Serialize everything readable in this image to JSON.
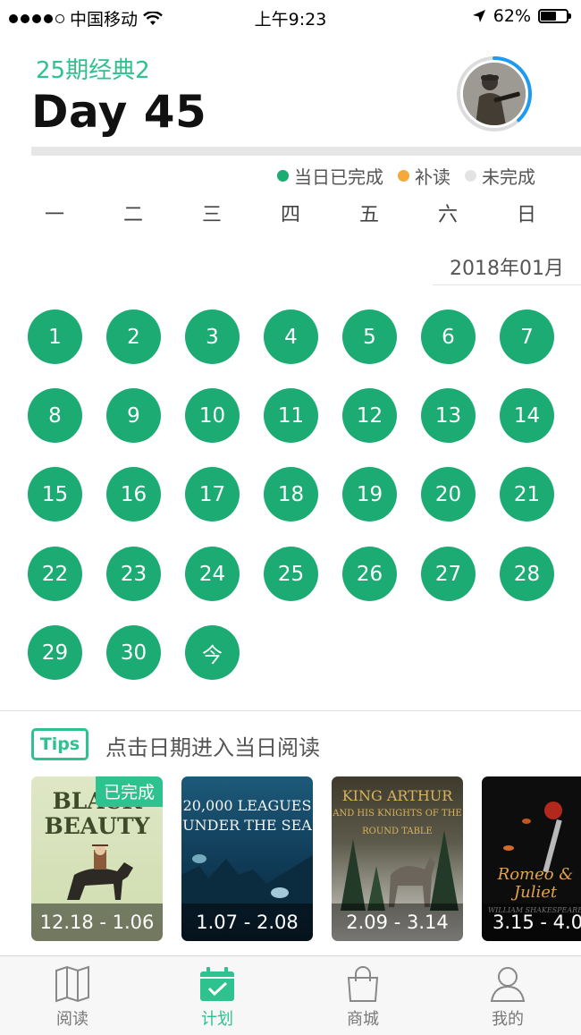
{
  "status_bar": {
    "carrier": "中国移动",
    "time": "上午9:23",
    "battery": "62%",
    "battery_level": 0.62
  },
  "header": {
    "plan_name": "25期经典2",
    "day_title": "Day 45",
    "progress": 0.38
  },
  "legend": [
    {
      "label": "当日已完成",
      "color": "#1bab73"
    },
    {
      "label": "补读",
      "color": "#f5a93b"
    },
    {
      "label": "未完成",
      "color": "#e3e3e3"
    }
  ],
  "weekdays": [
    "一",
    "二",
    "三",
    "四",
    "五",
    "六",
    "日"
  ],
  "month_label": "2018年01月",
  "days": [
    "1",
    "2",
    "3",
    "4",
    "5",
    "6",
    "7",
    "8",
    "9",
    "10",
    "11",
    "12",
    "13",
    "14",
    "15",
    "16",
    "17",
    "18",
    "19",
    "20",
    "21",
    "22",
    "23",
    "24",
    "25",
    "26",
    "27",
    "28",
    "29",
    "30",
    "今"
  ],
  "tips": {
    "badge": "Tips",
    "text": "点击日期进入当日阅读"
  },
  "books": [
    {
      "title_line1": "BLACK",
      "title_line2": "BEAUTY",
      "range": "12.18 - 1.06",
      "status": "已完成"
    },
    {
      "title_line1": "20,000 LEAGUES",
      "title_line2": "UNDER THE SEA",
      "range": "1.07 - 2.08"
    },
    {
      "title_line1": "KING ARTHUR",
      "title_line2": "AND HIS KNIGHTS OF THE ROUND TABLE",
      "range": "2.09 - 3.14"
    },
    {
      "title_line1": "Romeo & Juliet",
      "title_line2": "WILLIAM SHAKESPEARE",
      "range": "3.15 - 4.0"
    }
  ],
  "tabbar": [
    {
      "label": "阅读",
      "icon": "book-icon"
    },
    {
      "label": "计划",
      "icon": "calendar-check-icon"
    },
    {
      "label": "商城",
      "icon": "shopping-bag-icon"
    },
    {
      "label": "我的",
      "icon": "user-icon"
    }
  ]
}
